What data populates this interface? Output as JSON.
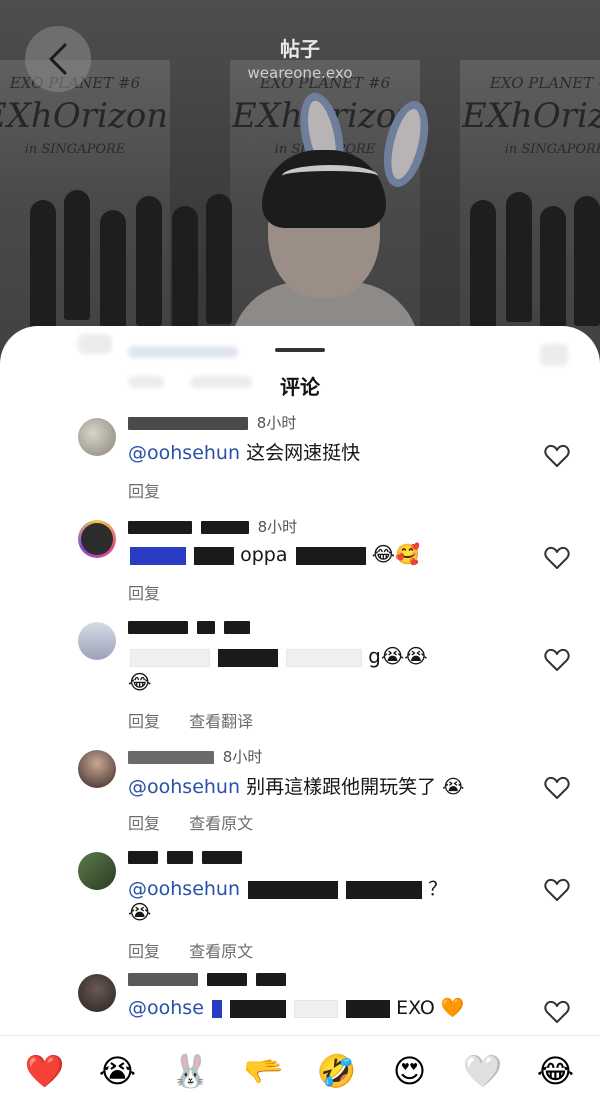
{
  "header": {
    "title": "帖子",
    "subtitle": "weareone.exo"
  },
  "poster": {
    "top_line": "EXO PLANET #6",
    "logo": "EXhOrizon",
    "sub": "in SINGAPORE"
  },
  "sheet": {
    "title": "评论"
  },
  "comments": [
    {
      "meta_suffix": "8小时",
      "mention": "@oohsehun",
      "text": "这会网速挺快",
      "reply": "回复",
      "extra_action": ""
    },
    {
      "meta_suffix": "8小时",
      "mention": "",
      "text": "oppa",
      "emoji": "😂🥰",
      "reply": "回复",
      "extra_action": ""
    },
    {
      "meta_suffix": "",
      "mention": "",
      "text": "g😭😭",
      "text_line2": "😂",
      "reply": "回复",
      "extra_action": "查看翻译"
    },
    {
      "meta_suffix": "8小时",
      "mention": "@oohsehun",
      "text": "别再這樣跟他開玩笑了 😭",
      "reply": "回复",
      "extra_action": "查看原文"
    },
    {
      "meta_suffix": "",
      "mention": "@oohsehun",
      "text": "？",
      "text_line2": "😭",
      "reply": "回复",
      "extra_action": "查看原文"
    },
    {
      "meta_suffix": "",
      "mention": "@oohse",
      "text": "EXO 🧡",
      "reply": "",
      "extra_action": ""
    }
  ],
  "reactions": [
    "❤️",
    "😭",
    "🐰",
    "🫳",
    "🤣",
    "😍",
    "🤍",
    "😂"
  ],
  "colors": {
    "mention": "#2850a8",
    "reaction_heart": "#e0202a"
  }
}
